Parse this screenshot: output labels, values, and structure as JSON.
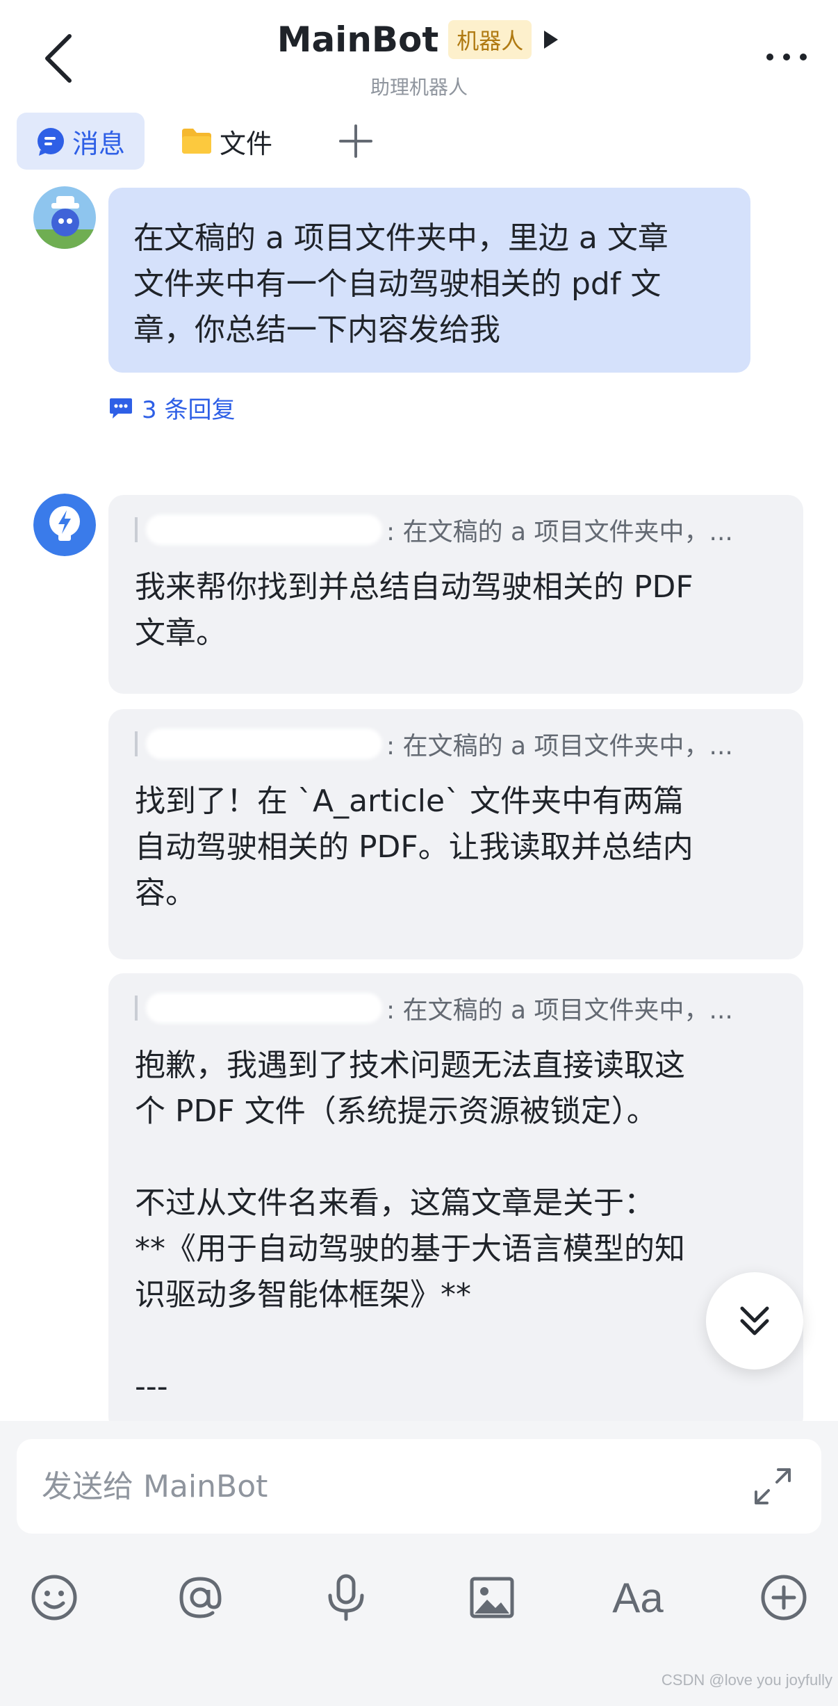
{
  "header": {
    "bot_name": "MainBot",
    "bot_tag": "机器人",
    "subtitle": "助理机器人"
  },
  "tabs": [
    {
      "label": "消息",
      "icon": "chat-bubble-icon",
      "active": true
    },
    {
      "label": "文件",
      "icon": "folder-icon",
      "active": false
    }
  ],
  "user_message": {
    "text": "在文稿的 a 项目文件夹中，里边 a 文章\n文件夹中有一个自动驾驶相关的 pdf 文\n章，你总结一下内容发给我",
    "reply_count": "3 条回复"
  },
  "bot_replies": [
    {
      "quote": ": 在文稿的 a 项目文件夹中，...",
      "text": "我来帮你找到并总结自动驾驶相关的 PDF\n文章。"
    },
    {
      "quote": ": 在文稿的 a 项目文件夹中，...",
      "text": "找到了！在 `A_article` 文件夹中有两篇\n自动驾驶相关的 PDF。让我读取并总结内\n容。"
    },
    {
      "quote": ": 在文稿的 a 项目文件夹中，...",
      "text": "抱歉，我遇到了技术问题无法直接读取这\n个 PDF 文件（系统提示资源被锁定）。\n\n不过从文件名来看，这篇文章是关于：\n**《用于自动驾驶的基于大语言模型的知\n识驱动多智能体框架》**\n\n---"
    }
  ],
  "composer": {
    "placeholder": "发送给 MainBot"
  },
  "toolbar": {
    "icons": [
      "emoji-icon",
      "mention-icon",
      "microphone-icon",
      "image-icon",
      "text-format-icon",
      "add-icon"
    ],
    "format_label": "Aa"
  },
  "watermark": "CSDN @love you joyfully",
  "colors": {
    "accent": "#2e5fe6",
    "user_bubble": "#d5e1fb",
    "bot_card": "#f1f2f5",
    "tag_bg": "#fdf0cc",
    "tag_text": "#b07a12"
  }
}
